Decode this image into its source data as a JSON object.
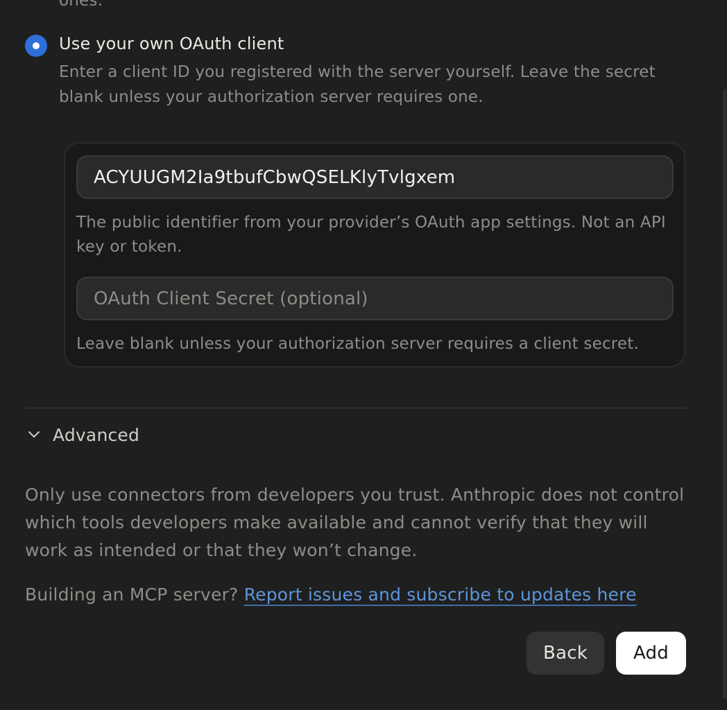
{
  "top_fragment": "ones.",
  "oauth_option": {
    "title": "Use your own OAuth client",
    "description": "Enter a client ID you registered with the server yourself. Leave the secret blank unless your authorization server requires one.",
    "selected": true
  },
  "client_id": {
    "value": "ACYUUGM2Ia9tbufCbwQSELKlyTvlgxem",
    "help": "The public identifier from your provider’s OAuth app settings. Not an API key or token."
  },
  "client_secret": {
    "placeholder": "OAuth Client Secret (optional)",
    "help": "Leave blank unless your authorization server requires a client secret."
  },
  "advanced": {
    "label": "Advanced",
    "icon": "chevron-down-icon"
  },
  "warning": "Only use connectors from developers you trust. Anthropic does not control which tools developers make available and cannot verify that they will work as intended or that they won’t change.",
  "building": {
    "prefix": "Building an MCP server?",
    "link_text": "Report issues and subscribe to updates here"
  },
  "buttons": {
    "back": "Back",
    "add": "Add"
  },
  "colors": {
    "background": "#1f1f1f",
    "accent": "#2f6fdb",
    "link": "#5c95dc"
  }
}
